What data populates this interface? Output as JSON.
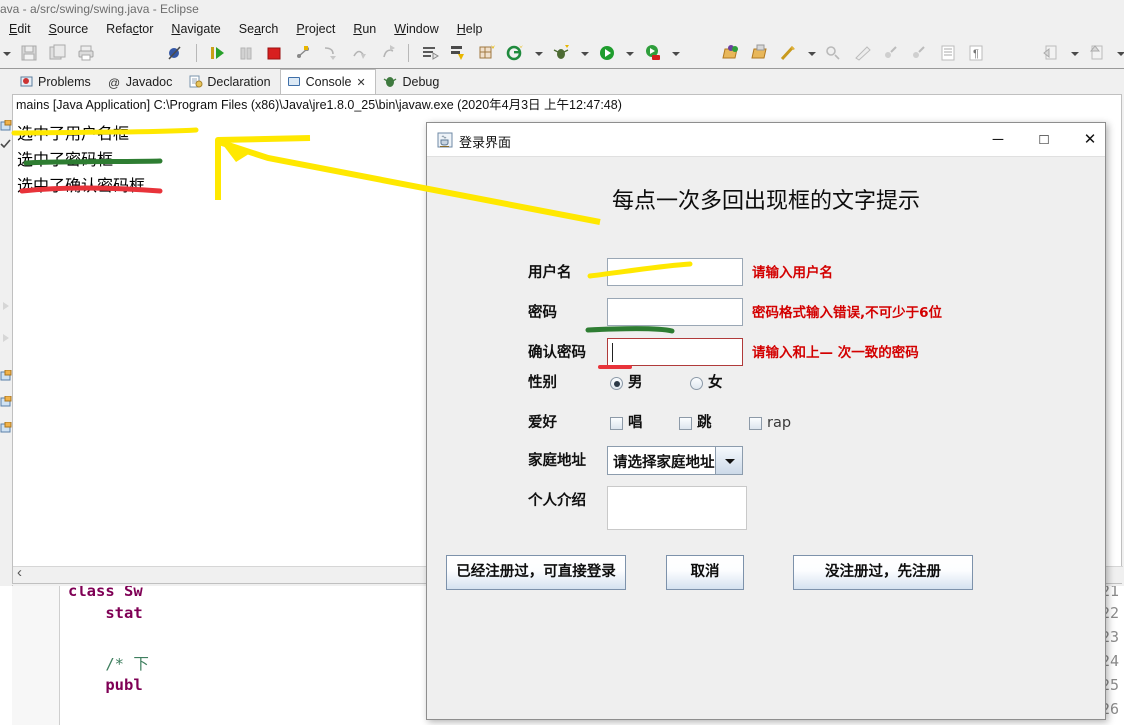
{
  "ide": {
    "window_title": "ava - a/src/swing/swing.java - Eclipse",
    "menu": [
      "Edit",
      "Source",
      "Refactor",
      "Navigate",
      "Search",
      "Project",
      "Run",
      "Window",
      "Help"
    ],
    "tabs": [
      {
        "label": "Problems",
        "icon": "problems-icon",
        "selected": false
      },
      {
        "label": "Javadoc",
        "icon": "javadoc-icon",
        "selected": false
      },
      {
        "label": "Declaration",
        "icon": "declaration-icon",
        "selected": false
      },
      {
        "label": "Console",
        "icon": "console-icon",
        "selected": true,
        "close": "✕"
      },
      {
        "label": "Debug",
        "icon": "debug-icon",
        "selected": false
      }
    ],
    "console": {
      "header": "mains [Java Application] C:\\Program Files (x86)\\Java\\jre1.8.0_25\\bin\\javaw.exe (2020年4月3日 上午12:47:48)",
      "lines": [
        "选中了用户名框",
        "选中了密码框",
        "选中了确认密码框"
      ]
    },
    "editor": {
      "line_numbers": [
        "21",
        "22",
        "23",
        "24",
        "25",
        "26"
      ],
      "code": [
        {
          "kw": "class",
          "rest": " Sw"
        },
        {
          "kw": "    stat",
          "rest": ""
        },
        {
          "kw": "",
          "rest": ""
        },
        {
          "kw": "",
          "rest": "    /* 下",
          "comment": true
        },
        {
          "kw": "    publ",
          "rest": ""
        },
        {
          "kw": "",
          "rest": ""
        }
      ]
    }
  },
  "dialog": {
    "title": "登录界面",
    "title_icon": "java-coffee-icon",
    "window_buttons": [
      {
        "name": "minimize-button",
        "glyph": "─"
      },
      {
        "name": "maximize-button",
        "glyph": "□"
      },
      {
        "name": "close-button",
        "glyph": "✕"
      }
    ],
    "heading": "每点一次多回出现框的文字提示",
    "fields": [
      {
        "label": "用户名",
        "value": "",
        "hint": "请输入用户名"
      },
      {
        "label": "密码",
        "value": "",
        "hint": "密码格式输入错误,不可少于6位"
      },
      {
        "label": "确认密码",
        "value": "",
        "hint": "请输入和上— 次一致的密码",
        "focused": true
      }
    ],
    "gender": {
      "label": "性别",
      "options": [
        {
          "text": "男",
          "checked": true
        },
        {
          "text": "女",
          "checked": false
        }
      ]
    },
    "hobby": {
      "label": "爱好",
      "options": [
        {
          "text": "唱",
          "checked": false
        },
        {
          "text": "跳",
          "checked": false
        },
        {
          "text": "rap",
          "checked": false
        }
      ]
    },
    "address": {
      "label": "家庭地址",
      "selected": "请选择家庭地址"
    },
    "intro": {
      "label": "个人介绍",
      "value": ""
    },
    "buttons": [
      {
        "name": "login-button",
        "label": "已经注册过，可直接登录"
      },
      {
        "name": "cancel-button",
        "label": "取消"
      },
      {
        "name": "register-button",
        "label": "没注册过，先注册"
      }
    ]
  },
  "annotations": {
    "colors": {
      "yellow": "#ffe800",
      "green": "#2e7d32",
      "red": "#e8333a"
    },
    "notes": [
      "yellow underline under 选中了用户名框",
      "green underline under 选中了密码框",
      "red underline under 选中了确认密码框",
      "yellow arrow pointing from dialog toward console",
      "yellow stroke under 用户名 field",
      "green stroke under 密码 field",
      "red stroke under 确认密码 field"
    ]
  }
}
